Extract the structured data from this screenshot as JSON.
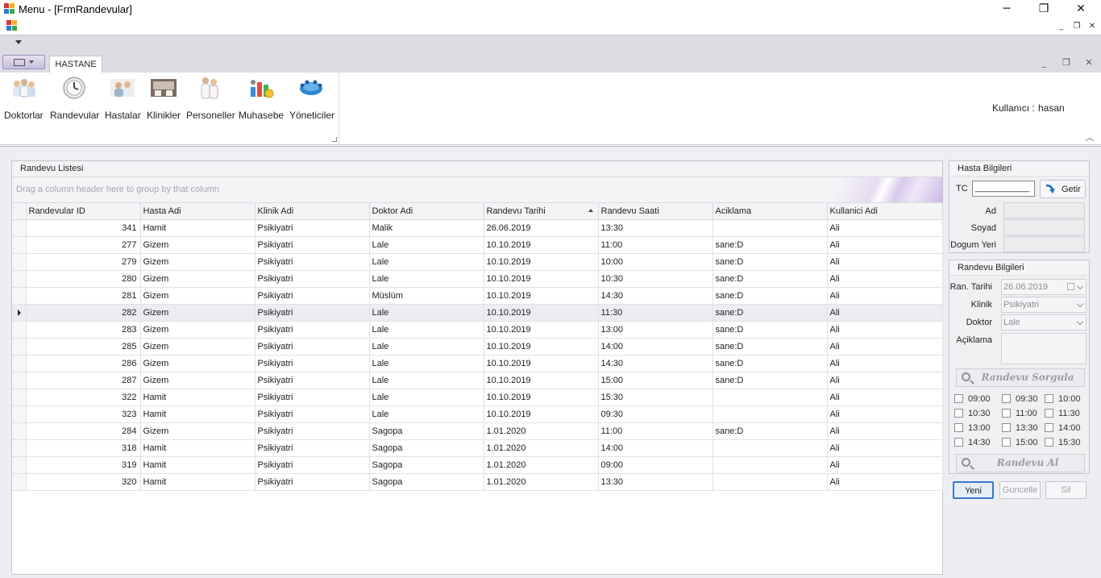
{
  "window": {
    "title": "Menu - [FrmRandevular]",
    "minimize_glyph": "─",
    "restore_glyph": "❐",
    "close_glyph": "✕"
  },
  "mdi": {
    "minimize_glyph": "_",
    "restore_glyph": "❐",
    "close_glyph": "✕"
  },
  "ribbon": {
    "tab": "HASTANE",
    "items": [
      {
        "label": "Doktorlar",
        "icon": "doctors-icon"
      },
      {
        "label": "Randevular",
        "icon": "appointments-icon"
      },
      {
        "label": "Hastalar",
        "icon": "patients-icon"
      },
      {
        "label": "Klinikler",
        "icon": "clinics-icon"
      },
      {
        "label": "Personeller",
        "icon": "staff-icon"
      },
      {
        "label": "Muhasebe",
        "icon": "accounting-icon"
      },
      {
        "label": "Yöneticiler",
        "icon": "managers-icon"
      }
    ],
    "user_label": "Kullanıcı :",
    "user_value": "hasan",
    "collapse_glyph": "︿"
  },
  "grid": {
    "caption": "Randevu Listesi",
    "group_hint": "Drag a column header here to group by that column",
    "columns": [
      "Randevular ID",
      "Hasta Adi",
      "Klinik Adi",
      "Doktor Adi",
      "Randevu Tarihi",
      "Randevu Saati",
      "Aciklama",
      "Kullanici Adi"
    ],
    "sorted_column": "Randevu Tarihi",
    "focused_row": 5,
    "rows": [
      [
        "341",
        "Hamit",
        "Psikiyatri",
        "Malik",
        "26.06.2019",
        "13:30",
        "",
        "Ali"
      ],
      [
        "277",
        "Gizem",
        "Psikiyatri",
        "Lale",
        "10.10.2019",
        "11:00",
        "sane:D",
        "Ali"
      ],
      [
        "279",
        "Gizem",
        "Psikiyatri",
        "Lale",
        "10.10.2019",
        "10:00",
        "sane:D",
        "Ali"
      ],
      [
        "280",
        "Gizem",
        "Psikiyatri",
        "Lale",
        "10.10.2019",
        "10:30",
        "sane:D",
        "Ali"
      ],
      [
        "281",
        "Gizem",
        "Psikiyatri",
        "Müslüm",
        "10.10.2019",
        "14:30",
        "sane:D",
        "Ali"
      ],
      [
        "282",
        "Gizem",
        "Psikiyatri",
        "Lale",
        "10.10.2019",
        "11:30",
        "sane:D",
        "Ali"
      ],
      [
        "283",
        "Gizem",
        "Psikiyatri",
        "Lale",
        "10.10.2019",
        "13:00",
        "sane:D",
        "Ali"
      ],
      [
        "285",
        "Gizem",
        "Psikiyatri",
        "Lale",
        "10.10.2019",
        "14:00",
        "sane:D",
        "Ali"
      ],
      [
        "286",
        "Gizem",
        "Psikiyatri",
        "Lale",
        "10.10.2019",
        "14:30",
        "sane:D",
        "Ali"
      ],
      [
        "287",
        "Gizem",
        "Psikiyatri",
        "Lale",
        "10.10.2019",
        "15:00",
        "sane:D",
        "Ali"
      ],
      [
        "322",
        "Hamit",
        "Psikiyatri",
        "Lale",
        "10.10.2019",
        "15:30",
        "",
        "Ali"
      ],
      [
        "323",
        "Hamit",
        "Psikiyatri",
        "Lale",
        "10.10.2019",
        "09:30",
        "",
        "Ali"
      ],
      [
        "284",
        "Gizem",
        "Psikiyatri",
        "Sagopa",
        "1.01.2020",
        "11:00",
        "sane:D",
        "Ali"
      ],
      [
        "318",
        "Hamit",
        "Psikiyatri",
        "Sagopa",
        "1.01.2020",
        "14:00",
        "",
        "Ali"
      ],
      [
        "319",
        "Hamit",
        "Psikiyatri",
        "Sagopa",
        "1.01.2020",
        "09:00",
        "",
        "Ali"
      ],
      [
        "320",
        "Hamit",
        "Psikiyatri",
        "Sagopa",
        "1.01.2020",
        "13:30",
        "",
        "Ali"
      ]
    ]
  },
  "hasta": {
    "caption": "Hasta Bilgileri",
    "tc_label": "TC",
    "tc_value": "___________",
    "getir": "Getir",
    "ad_label": "Ad",
    "soyad_label": "Soyad",
    "dogum_label": "Dogum Yeri"
  },
  "randevu": {
    "caption": "Randevu Bilgileri",
    "tarih_label": "Ran. Tarihi",
    "tarih_value": "26.06.2019",
    "klinik_label": "Klinik",
    "klinik_value": "Psikiyatri",
    "doktor_label": "Doktor",
    "doktor_value": "Lale",
    "aciklama_label": "Açiklama",
    "sorgula": "Randevu Sorgula",
    "times": [
      [
        "09:00",
        "09:30",
        "10:00"
      ],
      [
        "10:30",
        "11:00",
        "11:30"
      ],
      [
        "13:00",
        "13:30",
        "14:00"
      ],
      [
        "14:30",
        "15:00",
        "15:30"
      ]
    ],
    "al": "Randevu Al"
  },
  "actions": {
    "yeni": "Yeni",
    "guncelle": "Guncelle",
    "sil": "Sil"
  }
}
